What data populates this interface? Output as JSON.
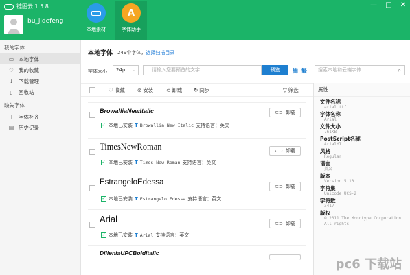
{
  "app": {
    "title": "链图云 1.5.8",
    "username": "bu_jidefeng"
  },
  "window_controls": [
    "—",
    "□",
    "✕"
  ],
  "nav": [
    {
      "label": "本地素材",
      "icon": "disk-icon"
    },
    {
      "label": "字体助手",
      "icon": "font-assistant-icon",
      "glyph": "A"
    }
  ],
  "sidebar": {
    "sections": [
      {
        "title": "我的字体",
        "items": [
          {
            "label": "本地字体",
            "icon": "monitor-icon",
            "glyph": "▭"
          },
          {
            "label": "我的收藏",
            "icon": "heart-icon",
            "glyph": "♡"
          },
          {
            "label": "下载管理",
            "icon": "download-icon",
            "glyph": "↓"
          },
          {
            "label": "回收站",
            "icon": "trash-icon",
            "glyph": "▯"
          }
        ]
      },
      {
        "title": "缺失字体",
        "items": [
          {
            "label": "字体补齐",
            "icon": "puzzle-icon",
            "glyph": "⁝"
          },
          {
            "label": "历史记录",
            "icon": "history-icon",
            "glyph": "▤"
          }
        ]
      }
    ]
  },
  "main": {
    "title": "本地字体",
    "count": "249个字体，",
    "scan_link": "选择扫描目录",
    "font_size_label": "字体大小",
    "font_size_value": "24pt",
    "preview_placeholder": "请输入您要预览的文字",
    "preview_button": "预览",
    "toggle_a": "簡",
    "toggle_b": "繁",
    "search_placeholder": "搜索本地和云端字体"
  },
  "toolbar": {
    "favorite": "收藏",
    "install": "安装",
    "uninstall": "卸载",
    "sync": "同步",
    "filter": "筛选"
  },
  "fonts": [
    {
      "name": "BrowalliaNewItalic",
      "status": "本地已安装",
      "preview": "Browallia New Italic",
      "lang": "支持语言：英文",
      "action": "卸载"
    },
    {
      "name": "TimesNewRoman",
      "status": "本地已安装",
      "preview": "Times New Roman",
      "lang": "支持语言：英文",
      "action": "卸载"
    },
    {
      "name": "EstrangeloEdessa",
      "status": "本地已安装",
      "preview": "Estrangelo Edessa",
      "lang": "支持语言：英文",
      "action": "卸载"
    },
    {
      "name": "Arial",
      "status": "本地已安装",
      "preview": "Arial",
      "lang": "支持语言：英文",
      "action": "卸载"
    },
    {
      "name": "DilleniaUPCBoldItalic",
      "status": "",
      "preview": "",
      "lang": "",
      "action": ""
    }
  ],
  "attributes": {
    "title": "属性",
    "fields": [
      {
        "key": "文件名称",
        "value": "arial.ttf"
      },
      {
        "key": "字体名称",
        "value": "Arial"
      },
      {
        "key": "文件大小",
        "value": "761KB"
      },
      {
        "key": "PostScript名称",
        "value": "ArialMT"
      },
      {
        "key": "风格",
        "value": "Regular"
      },
      {
        "key": "语言",
        "value": "英文"
      },
      {
        "key": "版本",
        "value": "Version 5.10"
      },
      {
        "key": "字符集",
        "value": "Unicode UCS-2"
      },
      {
        "key": "字符数",
        "value": "3417"
      },
      {
        "key": "版权",
        "value": "© 2011 The Monotype Corporation. All rights"
      }
    ]
  },
  "watermark": "pc6 下载站",
  "colors": {
    "brand": "#1bb468",
    "accent": "#1e7fd0"
  }
}
